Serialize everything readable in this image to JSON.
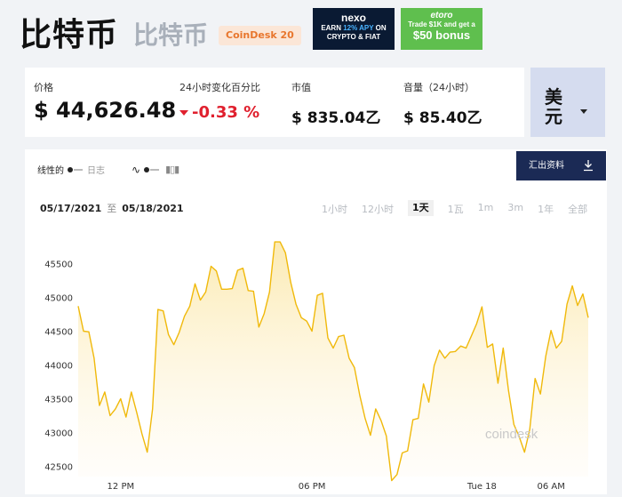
{
  "header": {
    "title": "比特币",
    "subtitle": "比特币",
    "badge": "CoinDesk 20"
  },
  "ads": {
    "nexo": {
      "brand": "nexo",
      "line1_a": "EARN ",
      "line1_b": "12% APY",
      "line1_c": " ON",
      "line2": "CRYPTO & FIAT"
    },
    "etoro": {
      "brand": "etoro",
      "line1": "Trade $1K and get a",
      "line2": "$50 bonus"
    }
  },
  "stats": {
    "price_label": "价格",
    "price_value": "$ 44,626.48",
    "change_label": "24小时变化百分比",
    "change_value": "-0.33 %",
    "mcap_label": "市值",
    "mcap_value": "$ 835.04乙",
    "volume_label": "音量（24小时）",
    "volume_value": "$ 85.40乙"
  },
  "currency": {
    "label": "美元"
  },
  "chart_controls": {
    "linear": "线性的",
    "log": "日志",
    "export": "汇出资料",
    "date_from": "05/17/2021",
    "date_sep": "至",
    "date_to": "05/18/2021",
    "ranges": [
      "1小时",
      "12小时",
      "1天",
      "1瓦",
      "1m",
      "3m",
      "1年",
      "全部"
    ],
    "active_range": "1天"
  },
  "colors": {
    "line": "#f0b90b",
    "fill": "#fdf3d2",
    "accent_dark": "#1b2a55",
    "negative": "#e0202e"
  },
  "chart_data": {
    "type": "area",
    "x_ticks": [
      "12 PM",
      "06 PM",
      "Tue 18",
      "06 AM"
    ],
    "y_ticks": [
      42500,
      43000,
      43500,
      44000,
      44500,
      45000,
      45500
    ],
    "ylim": [
      42350,
      45900
    ],
    "values": [
      44870,
      44500,
      44490,
      44100,
      43400,
      43600,
      43250,
      43350,
      43500,
      43230,
      43600,
      43300,
      42980,
      42710,
      43350,
      44820,
      44800,
      44450,
      44300,
      44480,
      44720,
      44870,
      45200,
      44960,
      45080,
      45460,
      45390,
      45120,
      45120,
      45130,
      45400,
      45430,
      45100,
      45090,
      44560,
      44760,
      45080,
      45820,
      45820,
      45660,
      45220,
      44900,
      44700,
      44650,
      44500,
      45030,
      45060,
      44400,
      44250,
      44420,
      44440,
      44100,
      43960,
      43550,
      43210,
      42960,
      43350,
      43180,
      42950,
      42290,
      42380,
      42700,
      42730,
      43190,
      43210,
      43720,
      43450,
      43990,
      44220,
      44100,
      44190,
      44200,
      44280,
      44250,
      44430,
      44610,
      44860,
      44260,
      44310,
      43730,
      44250,
      43620,
      43120,
      42940,
      42710,
      43050,
      43800,
      43570,
      44130,
      44510,
      44250,
      44350,
      44900,
      45170,
      44880,
      45050,
      44700
    ]
  },
  "watermark": "coindesk"
}
